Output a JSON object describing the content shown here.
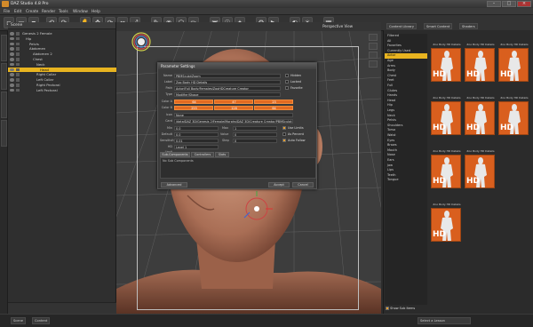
{
  "app": {
    "title": "DAZ Studio 4.8 Pro"
  },
  "menu": [
    "File",
    "Edit",
    "Create",
    "Render",
    "Tools",
    "Window",
    "Help"
  ],
  "scene": {
    "header": "Scene",
    "rows": [
      {
        "label": "Genesis 2 Female",
        "indent": 0
      },
      {
        "label": "Hip",
        "indent": 1
      },
      {
        "label": "Pelvis",
        "indent": 2
      },
      {
        "label": "Abdomen",
        "indent": 2
      },
      {
        "label": "Abdomen 2",
        "indent": 3
      },
      {
        "label": "Chest",
        "indent": 3
      },
      {
        "label": "Neck",
        "indent": 4
      },
      {
        "label": "Head",
        "indent": 5,
        "selected": true
      },
      {
        "label": "Right Collar",
        "indent": 4
      },
      {
        "label": "Left Collar",
        "indent": 4
      },
      {
        "label": "Right Pectoral",
        "indent": 4
      },
      {
        "label": "Left Pectoral",
        "indent": 4
      }
    ]
  },
  "viewport": {
    "view_label": "Perspective View"
  },
  "dialog": {
    "title": "Parameter Settings",
    "fields": [
      {
        "label": "Name",
        "value": "PBMSculptZoom"
      },
      {
        "label": "Label",
        "value": "Zoo Body HD Details"
      },
      {
        "label": "Path",
        "value": "Actor/Full Body/Females/ZooHDCreature Creator"
      },
      {
        "label": "Type",
        "value": "Modifier/Shape"
      }
    ],
    "checks": [
      "Hidden",
      "Locked",
      "Favorite"
    ],
    "color_a_label": "Color A",
    "color_a": [
      "64",
      "47",
      "23"
    ],
    "color_b_label": "Color B",
    "color_b": [
      "255",
      "128",
      "64"
    ],
    "icon_label": "Icon",
    "icon_value": "None",
    "card_label": "Card",
    "card_value": "/data/DAZ 3D/Genesis 2/Female/Morphs/DAZ 3D/Creature Creator/PBMSculpt.dsf",
    "min_label": "Min",
    "min_value": "0.0",
    "max_label": "Max",
    "max_value": "1",
    "default_label": "Default",
    "default_value": "0.0",
    "value_label": "Value",
    "value_value": "0",
    "step_label": "Sensitivity",
    "step_value": "0.01",
    "step2_label": "Step",
    "step2_value": "0",
    "hd_label": "HD Limit",
    "hd_value": "Level 1",
    "limits": [
      "Use Limits",
      "As Percent",
      "Auto Follow"
    ],
    "tabs": [
      "Sub-Components",
      "Controllers",
      "Slots"
    ],
    "subtext": "No Sub Components",
    "advanced": "Advanced",
    "accept": "Accept",
    "cancel": "Cancel"
  },
  "right": {
    "tabs": [
      "Content Library",
      "Smart Content",
      "Shaders"
    ],
    "categories": [
      "Filtered",
      "All",
      "Favorites",
      "Currently Used",
      "Actor",
      "Age",
      "Arms",
      "Body",
      "Chest",
      "Feet",
      "Full",
      "Glutes",
      "Hands",
      "Head",
      "Hip",
      "Legs",
      "Neck",
      "Pelvis",
      "Shoulders",
      "Torso",
      "Waist",
      "Eyes",
      "Brows",
      "Mouth",
      "Nose",
      "Ears",
      "Jaw",
      "Lips",
      "Teeth",
      "Tongue"
    ],
    "selected_category": "Actor",
    "thumbs": [
      "Zoo Body HD Details",
      "Zoo Body HD Details",
      "Zoo Body HD Details",
      "Zoo Body HD Details",
      "Zoo Body HD Details",
      "Zoo Body HD Details",
      "Zoo Body HD Details",
      "Zoo Body HD Details",
      "Zoo Body HD Details"
    ],
    "thumb_badge": "HD",
    "show_sub": "Show Sub Items"
  },
  "status": {
    "left_tab": "Scene",
    "left_tab2": "Content",
    "select_label": "Select a Lesson"
  }
}
